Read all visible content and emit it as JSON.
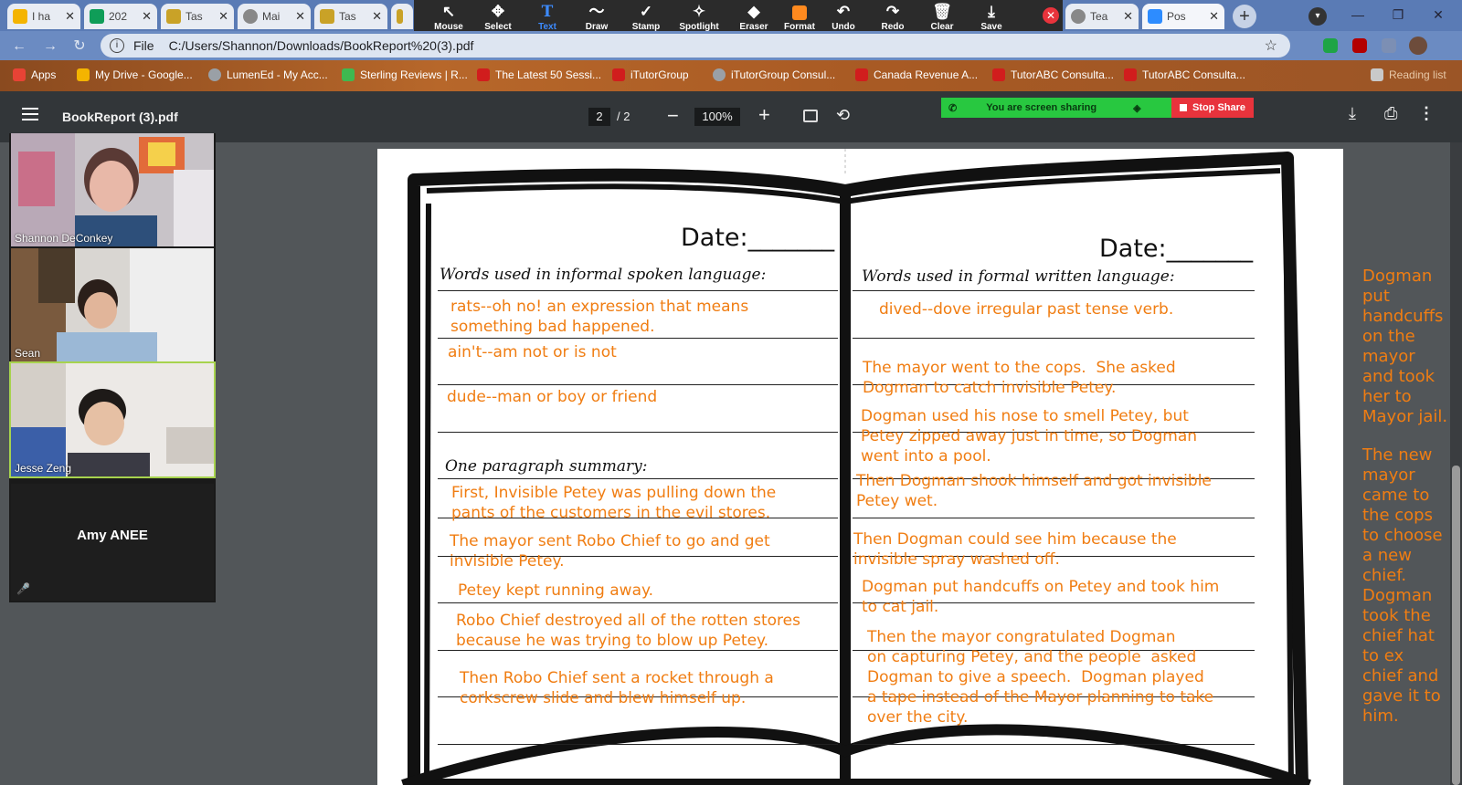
{
  "browser": {
    "tabs": [
      {
        "label": "I ha",
        "color": "#f4b400"
      },
      {
        "label": "202",
        "color": "#0f9d58"
      },
      {
        "label": "Tas",
        "color": "#c9a227"
      },
      {
        "label": "Mai",
        "color": "#888888"
      },
      {
        "label": "Tas",
        "color": "#c9a227"
      },
      {
        "label": "",
        "color": "#c9a227"
      },
      {
        "label": "Tea",
        "color": "#888888"
      },
      {
        "label": "Pos",
        "color": "#2d8cff"
      }
    ],
    "new_tab": "+",
    "address": {
      "scheme": "File",
      "url": "C:/Users/Shannon/Downloads/BookReport%20(3).pdf"
    },
    "bookmarks": [
      {
        "label": "Apps",
        "color": "#e84335"
      },
      {
        "label": "My Drive - Google...",
        "color": "#f4b400"
      },
      {
        "label": "LumenEd - My Acc...",
        "color": "#9aa0a6"
      },
      {
        "label": "Sterling Reviews | R...",
        "color": "#3fb950"
      },
      {
        "label": "The Latest 50 Sessi...",
        "color": "#d11d1d"
      },
      {
        "label": "iTutorGroup",
        "color": "#d11d1d"
      },
      {
        "label": "iTutorGroup Consul...",
        "color": "#9aa0a6"
      },
      {
        "label": "Canada Revenue A...",
        "color": "#d11d1d"
      },
      {
        "label": "TutorABC Consulta...",
        "color": "#d11d1d"
      },
      {
        "label": "TutorABC Consulta...",
        "color": "#d11d1d"
      },
      {
        "label": "Reading list",
        "color": "#c9c9c9"
      }
    ]
  },
  "annotate": {
    "tools": [
      {
        "label": "Mouse",
        "icon": "↖"
      },
      {
        "label": "Select",
        "icon": "✥"
      },
      {
        "label": "Text",
        "icon": "T"
      },
      {
        "label": "Draw",
        "icon": "〜"
      },
      {
        "label": "Stamp",
        "icon": "✓"
      },
      {
        "label": "Spotlight",
        "icon": "✧"
      },
      {
        "label": "Eraser",
        "icon": "◆"
      },
      {
        "label": "Format",
        "icon": "■"
      },
      {
        "label": "Undo",
        "icon": "↶"
      },
      {
        "label": "Redo",
        "icon": "↷"
      },
      {
        "label": "Clear",
        "icon": "🗑"
      },
      {
        "label": "Save",
        "icon": "⤓"
      }
    ],
    "active_tool": "Text",
    "format_color": "#ff8a1f"
  },
  "pdf": {
    "title": "BookReport (3).pdf",
    "page_current": "2",
    "page_total": "/  2",
    "zoom": "100%"
  },
  "share": {
    "status": "You are screen sharing",
    "stop": "Stop Share"
  },
  "participants": [
    {
      "name": "Shannon DeConkey"
    },
    {
      "name": "Sean"
    },
    {
      "name": "Jesse Zeng"
    },
    {
      "name": "Amy ANEE"
    }
  ],
  "worksheet": {
    "left_date": "Date:_______",
    "right_date": "Date:_______",
    "left_heading": "Words used in informal spoken language:",
    "right_heading": "Words used in formal written language:",
    "summary_heading": "One paragraph summary:",
    "left_answers": [
      "rats--oh no! an expression that means\nsomething bad happened.",
      "ain't--am not or is not",
      "dude--man or boy or friend",
      "First, Invisible Petey was pulling down the\npants of the customers in the evil stores.",
      "The mayor sent Robo Chief to go and get\ninvisible Petey.",
      "Petey kept running away.",
      "Robo Chief destroyed all of the rotten stores\nbecause he was trying to blow up Petey.",
      "Then Robo Chief sent a rocket through a\ncorkscrew slide and blew himself up."
    ],
    "right_answers": [
      "dived--dove irregular past tense verb.",
      "The mayor went to the cops.  She asked\nDogman to catch invisible Petey.",
      "Dogman used his nose to smell Petey, but\nPetey zipped away just in time, so Dogman\nwent into a pool.",
      "Then Dogman shook himself and got invisible\nPetey wet.",
      "Then Dogman could see him because the\ninvisible spray washed off.",
      "Dogman put handcuffs on Petey and took him\nto cat jail.",
      "Then the mayor congratulated Dogman\non capturing Petey, and the people  asked\nDogman to give a speech.  Dogman played\na tape instead of the Mayor planning to take\nover the city."
    ],
    "annotation_color": "#f07d12"
  },
  "side_annotation": [
    "Dogman put handcuffs on the mayor and took her to Mayor jail.",
    "The new mayor came to the cops to choose a new chief. Dogman took the chief hat to ex chief and gave it to him."
  ]
}
